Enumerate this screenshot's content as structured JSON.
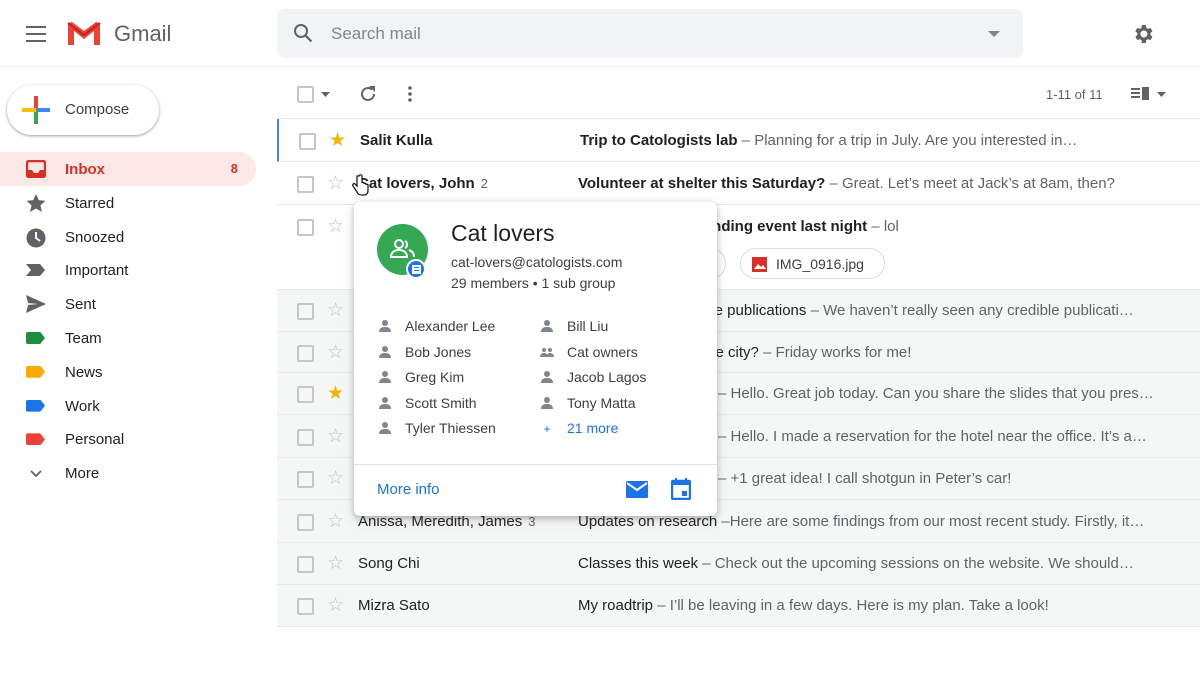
{
  "app": {
    "brand": "Gmail"
  },
  "search": {
    "placeholder": "Search mail"
  },
  "compose": {
    "label": "Compose"
  },
  "sidebar": {
    "items": [
      {
        "label": "Inbox",
        "count": "8",
        "icon": "inbox-icon"
      },
      {
        "label": "Starred",
        "icon": "star-icon"
      },
      {
        "label": "Snoozed",
        "icon": "clock-icon"
      },
      {
        "label": "Important",
        "icon": "important-icon"
      },
      {
        "label": "Sent",
        "icon": "send-icon"
      },
      {
        "label": "Team",
        "icon": "label-icon",
        "color": "#1e8e3e"
      },
      {
        "label": "News",
        "icon": "label-icon",
        "color": "#f9ab00"
      },
      {
        "label": "Work",
        "icon": "label-icon",
        "color": "#1a73e8"
      },
      {
        "label": "Personal",
        "icon": "label-icon",
        "color": "#ea4335"
      },
      {
        "label": "More",
        "icon": "chevron-down-icon"
      }
    ]
  },
  "toolbar": {
    "pagination": "1-11 of 11"
  },
  "emails": [
    {
      "from": "Salit Kulla",
      "subject": "Trip to Catologists lab",
      "snippet": " – Planning for a trip in July. Are you interested in…",
      "starred": true,
      "unread": true
    },
    {
      "from": "Cat lovers, John",
      "count": "2",
      "subject": "Volunteer at shelter this Saturday?",
      "snippet": " – Great. Let’s meet at Jack’s at 8am, then?",
      "starred": false,
      "unread": true
    },
    {
      "from": "",
      "subject": "onding event last night",
      "snippet": " – lol",
      "starred": false,
      "unread": true,
      "attachment": "IMG_0916.jpg"
    },
    {
      "from": "",
      "subject": "ble publications",
      "snippet": "  – We haven’t really seen any credible publicati…",
      "starred": false,
      "unread": false
    },
    {
      "from": "",
      "subject": "the city?",
      "snippet": " – Friday works for me!",
      "starred": false,
      "unread": false
    },
    {
      "from": "",
      "subject": "",
      "snippet": "– Hello. Great job today. Can you share the slides that you pres…",
      "starred": true,
      "unread": false
    },
    {
      "from": "",
      "subject": "",
      "snippet": "– Hello. I made a reservation for the hotel near the office. It’s a…",
      "starred": false,
      "unread": false
    },
    {
      "from": "",
      "subject": "",
      "snippet": "– +1 great idea! I call shotgun in Peter’s car!",
      "starred": false,
      "unread": false
    },
    {
      "from": "Anissa, Meredith, James",
      "count": "3",
      "subject": "Updates on research",
      "snippet": " –Here are some findings from our most recent study. Firstly, it…",
      "starred": false,
      "unread": false
    },
    {
      "from": "Song Chi",
      "subject": "Classes this week",
      "snippet": " – Check out the upcoming sessions on the website. We should…",
      "starred": false,
      "unread": false
    },
    {
      "from": "Mizra Sato",
      "subject": "My roadtrip",
      "snippet": " – I’ll be leaving in a few days. Here is my plan. Take a look!",
      "starred": false,
      "unread": false
    }
  ],
  "popup": {
    "title": "Cat lovers",
    "email": "cat-lovers@catologists.com",
    "members_summary": "29 members • 1 sub group",
    "members": [
      {
        "name": "Alexander Lee",
        "type": "person"
      },
      {
        "name": "Bill Liu",
        "type": "person"
      },
      {
        "name": "Bob Jones",
        "type": "person"
      },
      {
        "name": "Cat owners",
        "type": "group"
      },
      {
        "name": "Greg Kim",
        "type": "person"
      },
      {
        "name": "Jacob Lagos",
        "type": "person"
      },
      {
        "name": "Scott Smith",
        "type": "person"
      },
      {
        "name": "Tony Matta",
        "type": "person"
      },
      {
        "name": "Tyler Thiessen",
        "type": "person"
      },
      {
        "name": "21 more",
        "type": "more"
      }
    ],
    "more_info": "More info"
  },
  "colors": {
    "accent": "#1a73e8",
    "inbox": "#d93025",
    "star": "#f4b400",
    "group_avatar": "#34a853"
  }
}
